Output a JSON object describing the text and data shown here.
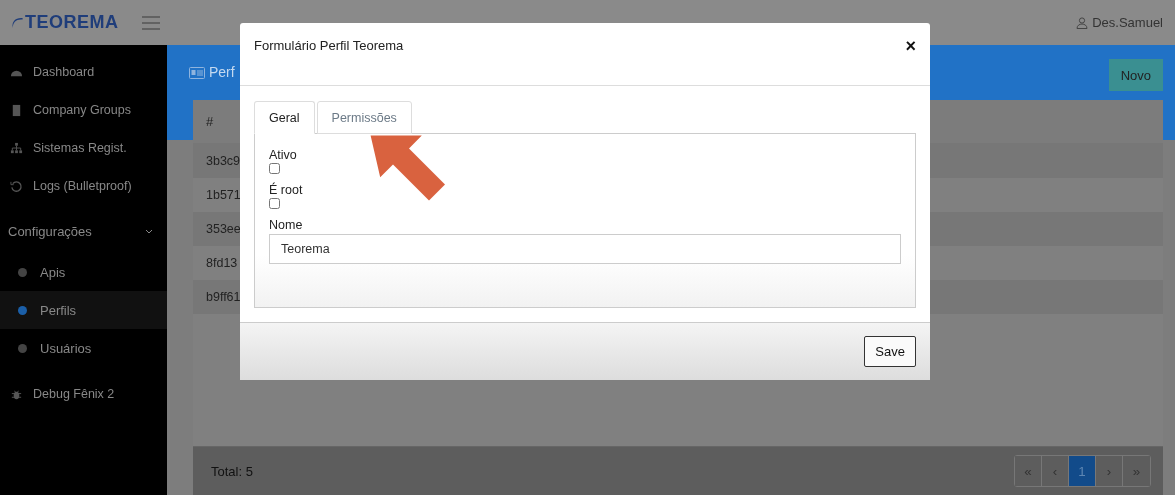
{
  "header": {
    "logo": "TEOREMA",
    "user": "Des.Samuel"
  },
  "sidebar": {
    "items": [
      {
        "label": "Dashboard",
        "kind": "gauge",
        "selected": false
      },
      {
        "label": "Company Groups",
        "kind": "building",
        "selected": false
      },
      {
        "label": "Sistemas Regist.",
        "kind": "sitemap",
        "selected": false
      },
      {
        "label": "Logs (Bulletproof)",
        "kind": "history",
        "selected": false
      },
      {
        "label": "Configurações",
        "expanded": true,
        "children": [
          {
            "label": "Apis",
            "selected": false
          },
          {
            "label": "Perfils",
            "selected": true
          },
          {
            "label": "Usuários",
            "selected": false
          }
        ]
      },
      {
        "label": "Debug Fênix 2",
        "kind": "bug",
        "selected": false
      }
    ]
  },
  "page": {
    "title": "Perf",
    "new_button": "Novo"
  },
  "table": {
    "columns": [
      "#"
    ],
    "rows": [
      [
        "3b3c9"
      ],
      [
        "1b571"
      ],
      [
        "353ee"
      ],
      [
        "8fd13"
      ],
      [
        "b9ff61"
      ]
    ],
    "total": "Total: 5"
  },
  "pagination": [
    {
      "label": "«",
      "selected": false
    },
    {
      "label": "‹",
      "selected": false
    },
    {
      "label": "1",
      "selected": true
    },
    {
      "label": "›",
      "selected": false
    },
    {
      "label": "»",
      "selected": false
    }
  ],
  "modal": {
    "title": "Formulário Perfil Teorema",
    "close": "×",
    "tabs": [
      {
        "label": "Geral",
        "selected": true
      },
      {
        "label": "Permissões",
        "selected": false
      }
    ],
    "fields": [
      {
        "kind": "checkbox",
        "label": "Ativo",
        "checked": false
      },
      {
        "kind": "checkbox",
        "label": "É root",
        "checked": false
      },
      {
        "kind": "text",
        "label": "Nome",
        "value": "Teorema"
      }
    ],
    "save": "Save"
  }
}
